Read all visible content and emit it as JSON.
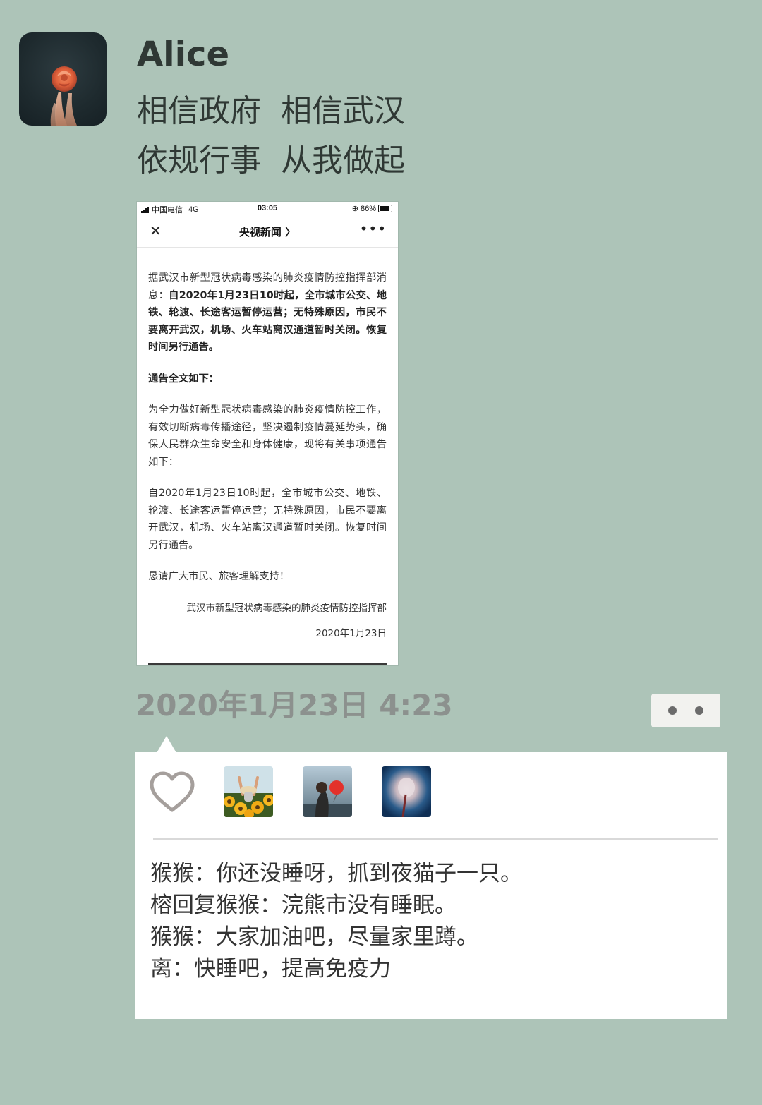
{
  "post": {
    "username": "Alice",
    "text_lines": [
      "相信政府  相信武汉",
      "依规行事  从我做起"
    ],
    "timestamp": "2020年1月23日 4:23"
  },
  "screenshot": {
    "status": {
      "carrier": "中国电信",
      "network": "4G",
      "time": "03:05",
      "battery": "86%"
    },
    "nav": {
      "close": "✕",
      "title": "央视新闻 〉",
      "more": "•••"
    },
    "paragraphs": [
      {
        "normal": "据武汉市新型冠状病毒感染的肺炎疫情防控指挥部消息：",
        "bold": "自2020年1月23日10时起，全市城市公交、地铁、轮渡、长途客运暂停运营；无特殊原因，市民不要离开武汉，机场、火车站离汉通道暂时关闭。恢复时间另行通告。"
      },
      {
        "bold": "通告全文如下："
      },
      {
        "normal": "为全力做好新型冠状病毒感染的肺炎疫情防控工作，有效切断病毒传播途径，坚决遏制疫情蔓延势头，确保人民群众生命安全和身体健康，现将有关事项通告如下："
      },
      {
        "normal": "自2020年1月23日10时起，全市城市公交、地铁、轮渡、长途客运暂停运营；无特殊原因，市民不要离开武汉，机场、火车站离汉通道暂时关闭。恢复时间另行通告。"
      },
      {
        "normal": "恳请广大市民、旅客理解支持！"
      }
    ],
    "signature": "武汉市新型冠状病毒感染的肺炎疫情防控指挥部",
    "date": "2020年1月23日"
  },
  "likes": {
    "icon": "heart-outline-icon",
    "avatars": [
      "sunflower-field-avatar",
      "girl-with-red-balloon-avatar",
      "blurred-figure-avatar"
    ]
  },
  "comments": [
    "猴猴：你还没睡呀，抓到夜猫子一只。",
    "榕回复猴猴：浣熊市没有睡眠。",
    "猴猴：大家加油吧，尽量家里蹲。",
    "离：快睡吧，提高免疫力"
  ],
  "colors": {
    "background": "#adc4b8",
    "panel": "#ffffff",
    "timestamp": "#8c918e",
    "text": "#2f3834"
  }
}
